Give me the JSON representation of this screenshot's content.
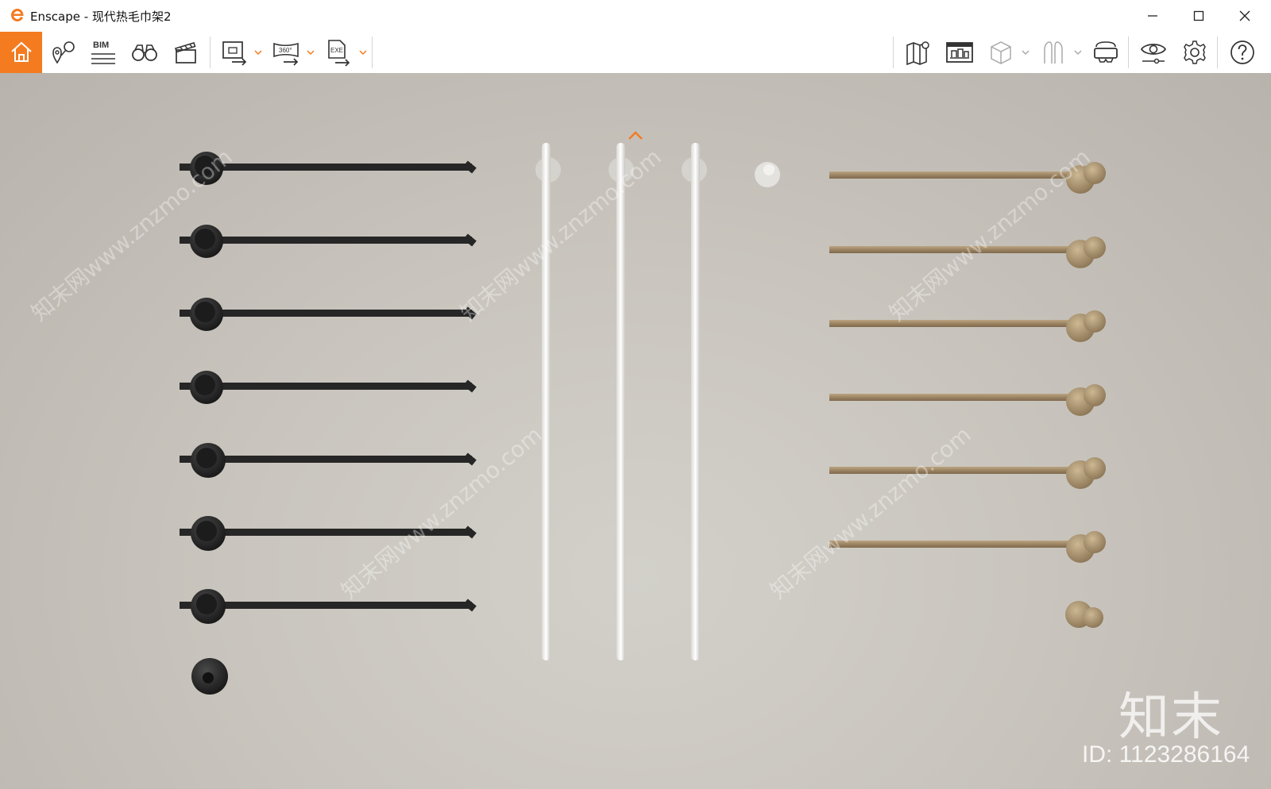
{
  "window": {
    "title": "Enscape - 现代热毛巾架2"
  },
  "toolbar": {
    "home": "home-icon",
    "left_tools": [
      "location-pin-icon",
      "bim-icon",
      "binoculars-icon",
      "clapperboard-icon",
      "export-image-icon",
      "export-360-icon",
      "export-exe-icon"
    ],
    "bim_label": "BIM",
    "export_360_label": "360°",
    "export_exe_label": "EXE",
    "right_tools": [
      "map-icon",
      "asset-library-icon",
      "cube-icon",
      "vr-figure-icon",
      "vr-headset-icon",
      "visual-settings-icon",
      "settings-icon",
      "help-icon"
    ],
    "accent": "#f47b20"
  },
  "scene": {
    "black_rails": 7,
    "white_vertical_rails": 3,
    "brass_rails": 6,
    "colors": {
      "black": "#242424",
      "white": "#ecebe8",
      "brass": "#9c8463",
      "wall": "#cbc7c0"
    }
  },
  "watermark": {
    "brand": "知末",
    "id": "ID: 1123286164",
    "diagonal": "知末网www.znzmo.com"
  }
}
